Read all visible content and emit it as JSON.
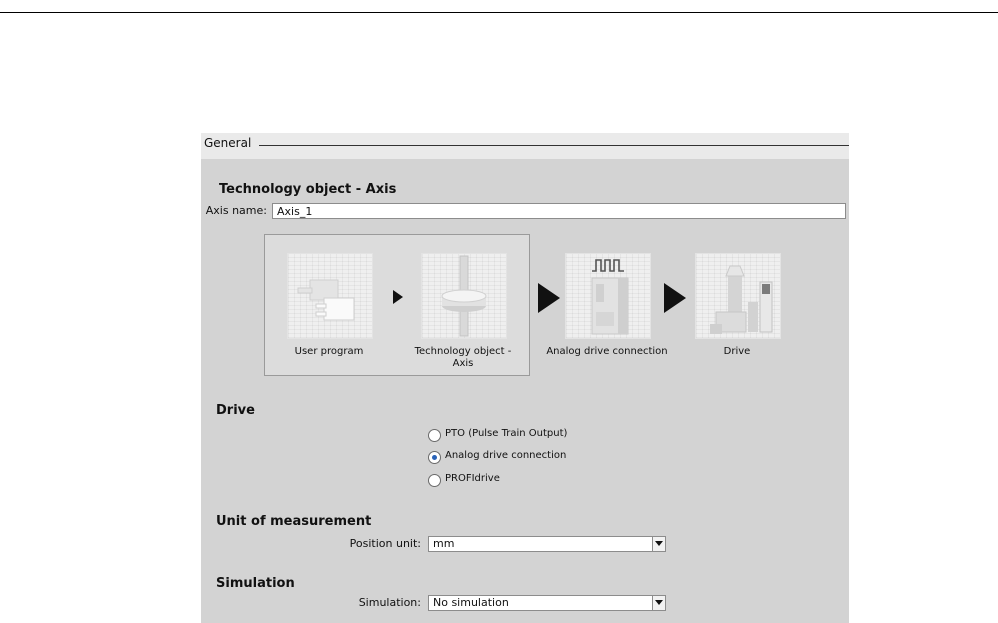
{
  "panel": {
    "title": "General"
  },
  "tech_object": {
    "heading": "Technology object - Axis",
    "axis_name_label": "Axis name:",
    "axis_name_value": "Axis_1"
  },
  "workflow": {
    "steps": [
      {
        "caption": "User program",
        "icon": "user-program-icon"
      },
      {
        "caption": "Technology object -\nAxis",
        "icon": "technology-object-axis-icon"
      },
      {
        "caption": "Analog drive connection",
        "icon": "analog-drive-connection-icon"
      },
      {
        "caption": "Drive",
        "icon": "drive-icon"
      }
    ]
  },
  "drive": {
    "heading": "Drive",
    "options": [
      {
        "label": "PTO (Pulse Train Output)",
        "selected": false
      },
      {
        "label": "Analog drive connection",
        "selected": true
      },
      {
        "label": "PROFIdrive",
        "selected": false
      }
    ]
  },
  "unit": {
    "heading": "Unit of measurement",
    "position_unit_label": "Position unit:",
    "position_unit_value": "mm"
  },
  "simulation": {
    "heading": "Simulation",
    "simulation_label": "Simulation:",
    "simulation_value": "No simulation"
  },
  "colors": {
    "panel_bg": "#d3d3d3",
    "radio_selected": "#2a63b8"
  }
}
